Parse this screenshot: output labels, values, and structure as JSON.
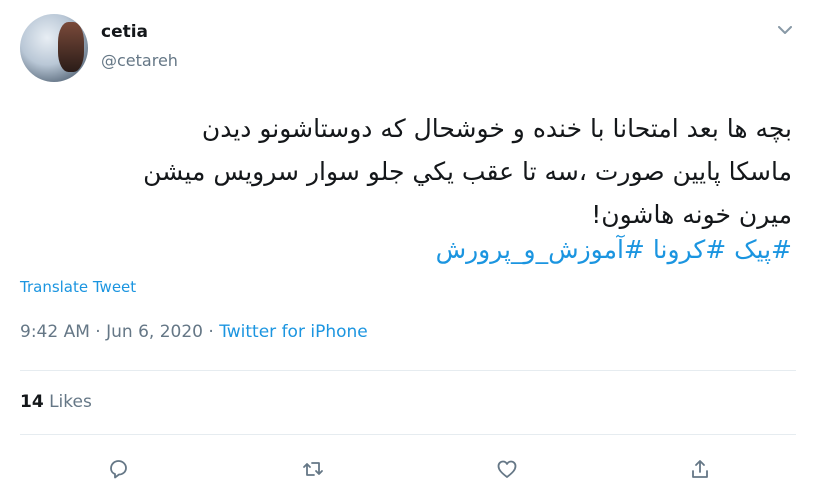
{
  "user": {
    "display_name": "cetia",
    "handle": "@cetareh"
  },
  "tweet": {
    "lines": [
      "بچه ها بعد امتحانا با خنده و خوشحال که دوستاشونو دیدن",
      "ماسکا پایین صورت ،سه تا عقب یکي جلو سوار سرویس میشن",
      "میرن خونه هاشون!"
    ],
    "hashtags": [
      "#پیک",
      "#کرونا",
      "#آموزش_و_پرورش"
    ]
  },
  "translate_label": "Translate Tweet",
  "meta": {
    "time": "9:42 AM",
    "date": "Jun 6, 2020",
    "source": "Twitter for iPhone",
    "separator": " · "
  },
  "stats": {
    "likes_count": "14",
    "likes_label": "Likes"
  },
  "actions": [
    "reply-icon",
    "retweet-icon",
    "like-icon",
    "share-icon"
  ],
  "colors": {
    "link": "#1b95e0",
    "secondary_text": "#657786",
    "divider": "#e6ecf0"
  }
}
